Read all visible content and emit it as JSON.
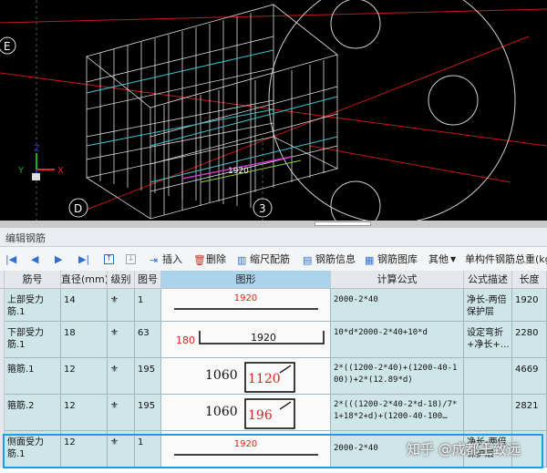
{
  "viewport": {
    "axis_labels": {
      "e": "E",
      "d": "D",
      "three": "3"
    },
    "dimension_text": "1920",
    "axes": {
      "x": "X",
      "y": "Y",
      "z": "Z"
    }
  },
  "panel": {
    "title": "编辑钢筋"
  },
  "toolbar": {
    "insert": "插入",
    "delete": "删除",
    "scale": "缩尺配筋",
    "info": "钢筋信息",
    "library": "钢筋图库",
    "other": "其他",
    "total_weight": "单构件钢筋总重(kg"
  },
  "table": {
    "headers": [
      "筋号",
      "直径(mm)",
      "级别",
      "图号",
      "图形",
      "计算公式",
      "公式描述",
      "长度"
    ],
    "rows": [
      {
        "name": "上部受力筋.1",
        "dia": "14",
        "level": "⚜",
        "fig": "1",
        "formula": "2000-2*40",
        "desc": "净长-两倍保护层",
        "length": "1920",
        "shape": {
          "main": "1920"
        }
      },
      {
        "name": "下部受力筋.1",
        "dia": "18",
        "level": "⚜",
        "fig": "63",
        "formula": "10*d*2000-2*40+10*d",
        "desc": "设定弯折+净长+…",
        "length": "2280",
        "shape": {
          "left": "180",
          "main": "1920"
        }
      },
      {
        "name": "箍筋.1",
        "dia": "12",
        "level": "⚜",
        "fig": "195",
        "formula": "2*((1200-2*40)+(1200-40-100))+2*(12.89*d)",
        "desc": "",
        "length": "4669",
        "shape": {
          "left": "1060",
          "main": "1120"
        }
      },
      {
        "name": "箍筋.2",
        "dia": "12",
        "level": "⚜",
        "fig": "195",
        "formula": "2*(((1200-2*40-2*d-18)/7*1+18*2+d)+(1200-40-100…",
        "desc": "",
        "length": "2821",
        "shape": {
          "left": "1060",
          "main": "196"
        }
      },
      {
        "name": "侧面受力筋.1",
        "dia": "12",
        "level": "⚜",
        "fig": "1",
        "formula": "2000-2*40",
        "desc": "净长-两倍保护层",
        "length": "",
        "shape": {
          "main": "1920"
        }
      }
    ]
  },
  "watermark": "知乎 @成都王致远",
  "colors": {
    "accent": "#1e9be8",
    "row_bg": "#cfe6e8",
    "dim_red": "#d9231c"
  }
}
